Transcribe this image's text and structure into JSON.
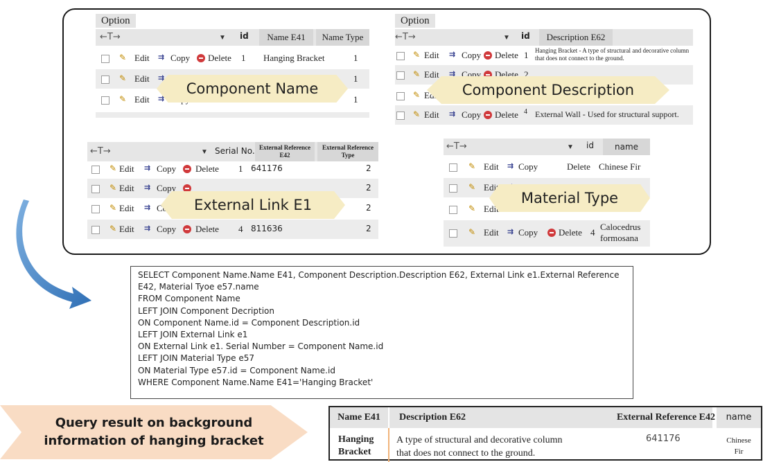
{
  "component_name_table": {
    "option_label": "Option",
    "headers": [
      "id",
      "Name E41",
      "Name Type"
    ],
    "rows": [
      {
        "edit": "Edit",
        "copy": "Copy",
        "delete": "Delete",
        "id": "1",
        "name": "Hanging Bracket",
        "type": "1"
      },
      {
        "edit": "Edit",
        "copy": "Co",
        "delete": "",
        "id": "",
        "name": "",
        "type": "1"
      },
      {
        "edit": "Edit",
        "copy": "Copy",
        "delete": "Delete",
        "id": "",
        "name": "",
        "type": "1"
      }
    ],
    "callout": "Component Name"
  },
  "component_description_table": {
    "option_label": "Option",
    "headers": [
      "id",
      "Description  E62"
    ],
    "rows": [
      {
        "edit": "Edit",
        "copy": "Copy",
        "delete": "Delete",
        "id": "1",
        "desc": "Hanging Bracket - A type of structural and decorative column that does not connect to the ground."
      },
      {
        "edit": "Edit",
        "copy": "Copy",
        "delete": "Delete",
        "id": "2",
        "desc": ""
      },
      {
        "edit": "Edit",
        "copy": "",
        "delete": "",
        "id": "",
        "desc": ""
      },
      {
        "edit": "Edit",
        "copy": "Copy",
        "delete": "Delete",
        "id": "4",
        "desc": "External Wall - Used for structural support."
      }
    ],
    "callout": "Component Description"
  },
  "external_link_table": {
    "headers": [
      "Serial No.",
      "External Reference E42",
      "External Reference Type"
    ],
    "rows": [
      {
        "edit": "Edit",
        "copy": "Copy",
        "delete": "Delete",
        "serial": "1",
        "ref": "641176",
        "type": "2"
      },
      {
        "edit": "Edit",
        "copy": "Copy",
        "delete": "Delete",
        "serial": "",
        "ref": "",
        "type": "2"
      },
      {
        "edit": "Edit",
        "copy": "Copy",
        "delete": "",
        "serial": "",
        "ref": "",
        "type": "2"
      },
      {
        "edit": "Edit",
        "copy": "Copy",
        "delete": "Delete",
        "serial": "4",
        "ref": "811636",
        "type": "2"
      }
    ],
    "callout": "External Link E1"
  },
  "material_type_table": {
    "headers": [
      "id",
      "name"
    ],
    "rows": [
      {
        "edit": "Edit",
        "copy": "Copy",
        "delete": "Delete",
        "id": "",
        "name": "Chinese Fir"
      },
      {
        "edit": "Edit",
        "copy": "",
        "delete": "",
        "id": "",
        "name": ""
      },
      {
        "edit": "Edit",
        "copy": "",
        "delete": "",
        "id": "",
        "name": ""
      },
      {
        "edit": "Edit",
        "copy": "Copy",
        "delete": "Delete",
        "id": "4",
        "name": "Calocedrus formosana"
      }
    ],
    "callout": "Material Type"
  },
  "sql_lines": [
    "SELECT Component Name.Name E41, Component Description.Description E62, External Link e1.External Reference",
    "E42, Material Tyoe e57.name",
    "FROM Component Name",
    "LEFT JOIN Component Decription",
    "ON Component Name.id = Component Description.id",
    "LEFT JOIN External Link e1",
    "ON External Link e1. Serial Number = Component Name.id",
    "LEFT JOIN Material Type e57",
    "ON Material Type e57.id = Component Name.id",
    "WHERE Component Name.Name E41='Hanging Bracket'"
  ],
  "query_label": {
    "line1": "Query result on background",
    "line2": "information of hanging bracket"
  },
  "result_table": {
    "headers": {
      "name": "Name E41",
      "desc": "Description  E62",
      "ref": "External Reference E42",
      "mat": "name"
    },
    "row": {
      "name_l1": "Hanging",
      "name_l2": "Bracket",
      "desc_l1": "A type of structural and decorative column",
      "desc_l2": "that does not connect to the ground.",
      "ref": "641176",
      "mat_l1": "Chinese",
      "mat_l2": "Fir"
    }
  },
  "colors": {
    "callout_gold": "#f6ecc4",
    "query_arrow": "#f9dcc4",
    "flow_arrow": "#2f6fb5"
  }
}
